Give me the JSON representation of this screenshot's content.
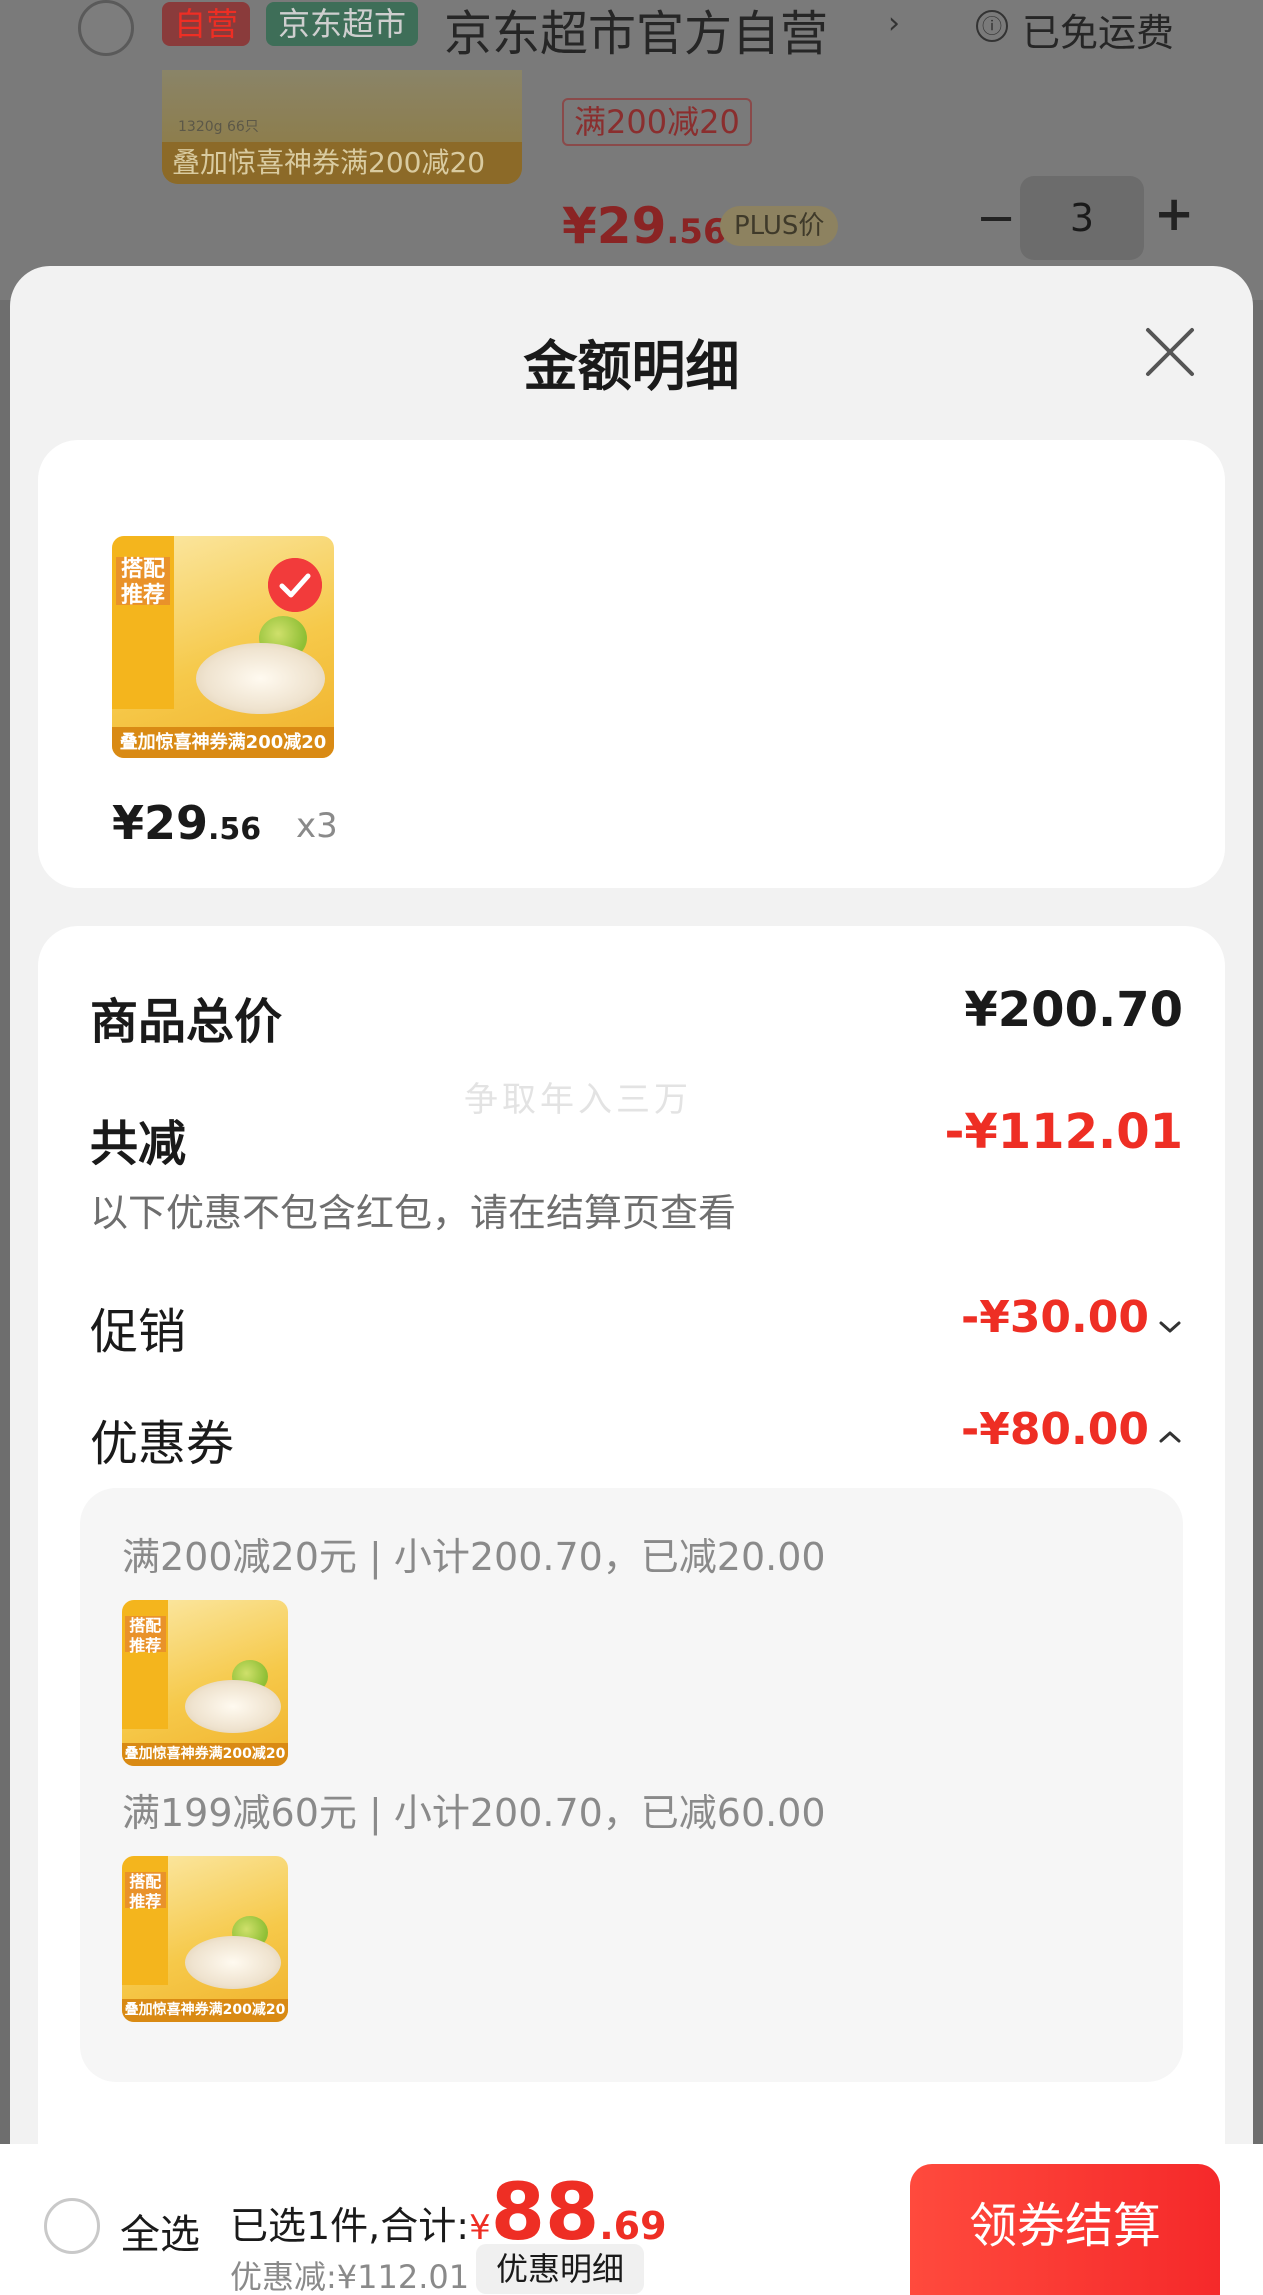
{
  "background_cart": {
    "tag_self": "自营",
    "tag_market": "京东超市",
    "store_name": "京东超市官方自营",
    "store_chevron": "›",
    "info_icon": "ⓘ",
    "free_shipping": "已免运费",
    "product_weight": "1320g 66只",
    "product_banner": "叠加惊喜神券满200减20",
    "coupon_tag": "满200减20",
    "price_symbol": "¥",
    "price_int": "29",
    "price_dec": ".56",
    "plus_badge": "PLUS价",
    "minus": "−",
    "quantity": "3",
    "plus": "+"
  },
  "sheet": {
    "title": "金额明细",
    "close_icon": "close-icon"
  },
  "products_card": {
    "thumb": {
      "recommend_text": "搭配推荐",
      "banner_text": "叠加惊喜神券满200减20",
      "selected": true
    },
    "price_int": "¥29",
    "price_dec": ".56",
    "quantity_label": "x3"
  },
  "summary": {
    "total_label": "商品总价",
    "total_value": "¥200.70",
    "reduce_label": "共减",
    "reduce_value": "-¥112.01",
    "reduce_note": "以下优惠不包含红包，请在结算页查看",
    "promo_label": "促销",
    "promo_value": "-¥30.00",
    "coupon_label": "优惠券",
    "coupon_value": "-¥80.00",
    "coupon_details": [
      {
        "text": "满200减20元 | 小计200.70，已减20.00"
      },
      {
        "text": "满199减60元 | 小计200.70，已减60.00"
      }
    ]
  },
  "watermark": "争取年入三万",
  "bottom_bar": {
    "select_all": "全选",
    "selected_prefix": "已选1件,合计:",
    "total_symbol": "¥",
    "total_int": "88",
    "total_dec": ".69",
    "discount_text": "优惠减:¥112.01",
    "detail_button": "优惠明细",
    "checkout_button": "领券结算"
  },
  "colors": {
    "accent_red": "#ee2e24",
    "sheet_bg": "#f2f2f2",
    "card_bg": "#ffffff"
  }
}
